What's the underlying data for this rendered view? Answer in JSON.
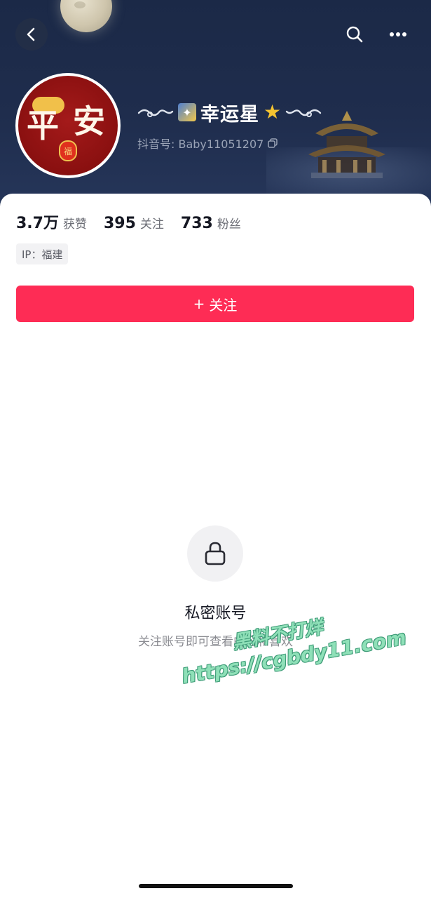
{
  "header": {
    "nickname": "幸运星",
    "account_id": "抖音号: Baby11051207",
    "avatar_text": [
      "平",
      "安"
    ],
    "avatar_lantern_text": "福",
    "icons": {
      "back": "back-chevron-icon",
      "search": "search-icon",
      "more": "more-dots-icon",
      "copy": "copy-icon"
    }
  },
  "stats": [
    {
      "value": "3.7万",
      "label": "获赞"
    },
    {
      "value": "395",
      "label": "关注"
    },
    {
      "value": "733",
      "label": "粉丝"
    }
  ],
  "ip_tag": "IP：福建",
  "follow_button": {
    "icon": "+",
    "label": "关注"
  },
  "private_account": {
    "icon": "lock-icon",
    "title": "私密账号",
    "subtitle": "关注账号即可查看内容和喜欢"
  },
  "watermark": {
    "line1": "黑料不打烊",
    "line2": "https://cgbdy11.com"
  },
  "colors": {
    "header_bg": "#1f2d4d",
    "follow_button": "#fe2c55",
    "watermark": "#8fe0b8"
  }
}
